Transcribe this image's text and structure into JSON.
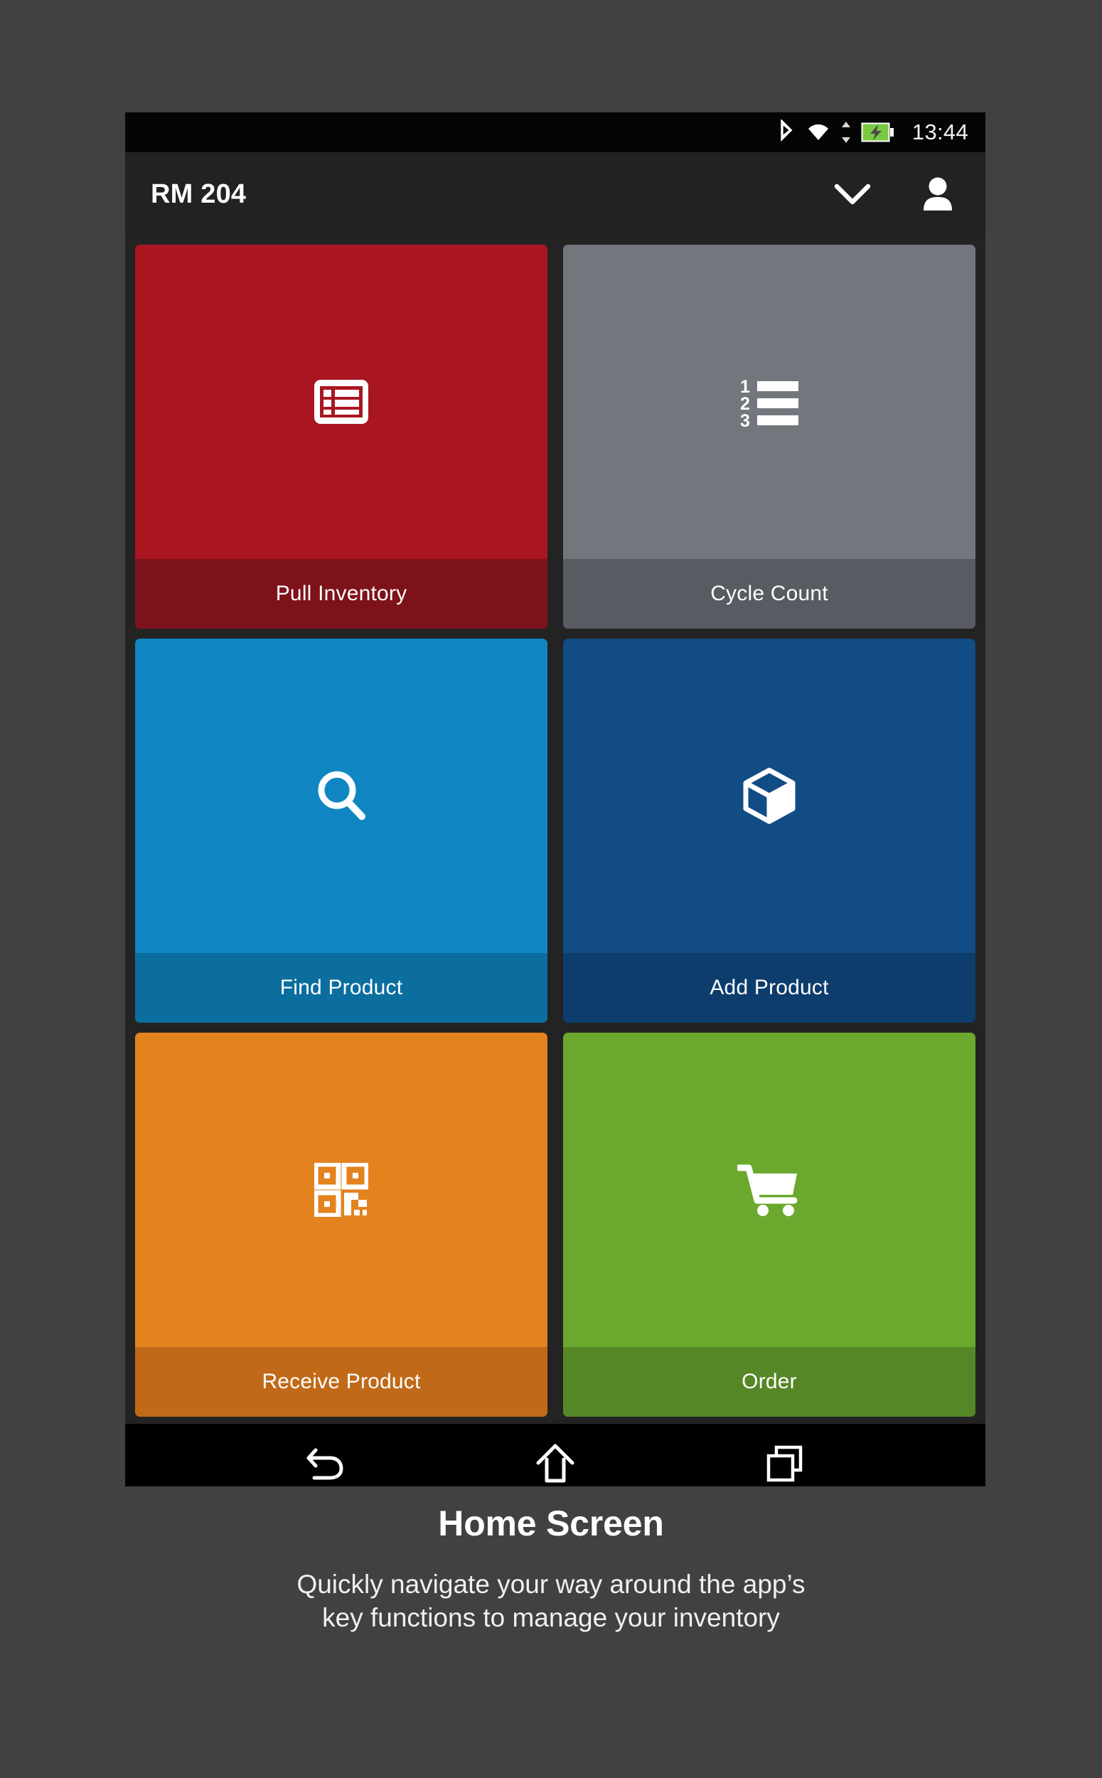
{
  "statusbar": {
    "time": "13:44",
    "icons": [
      "bluetooth-icon",
      "wifi-icon",
      "data-transfer-icon",
      "battery-charging-icon"
    ]
  },
  "appbar": {
    "title": "RM 204",
    "actions": [
      {
        "name": "chevron-down-icon",
        "label": "Expand"
      },
      {
        "name": "user-account-icon",
        "label": "Account"
      }
    ]
  },
  "tiles": [
    {
      "label": "Pull Inventory",
      "icon": "list-rows-icon",
      "color": "#A91620",
      "footer_color": "#7E121B"
    },
    {
      "label": "Cycle Count",
      "icon": "numbered-list-icon",
      "color": "#73777D",
      "footer_color": "#585C62"
    },
    {
      "label": "Find Product",
      "icon": "search-icon",
      "color": "#0F86C2",
      "footer_color": "#0B6E9F"
    },
    {
      "label": "Add Product",
      "icon": "box-3d-icon",
      "color": "#114C85",
      "footer_color": "#0D3D6C"
    },
    {
      "label": "Receive Product",
      "icon": "qr-code-icon",
      "color": "#E4821E",
      "footer_color": "#C06A19"
    },
    {
      "label": "Order",
      "icon": "shopping-cart-icon",
      "color": "#6BA82E",
      "footer_color": "#568726"
    }
  ],
  "navbar": {
    "buttons": [
      {
        "name": "back-icon",
        "label": "Back"
      },
      {
        "name": "home-icon",
        "label": "Home"
      },
      {
        "name": "recents-icon",
        "label": "Recent apps"
      }
    ]
  },
  "caption": {
    "title": "Home Screen",
    "line1": "Quickly navigate your way around the app’s",
    "line2": "key functions to manage your inventory"
  }
}
